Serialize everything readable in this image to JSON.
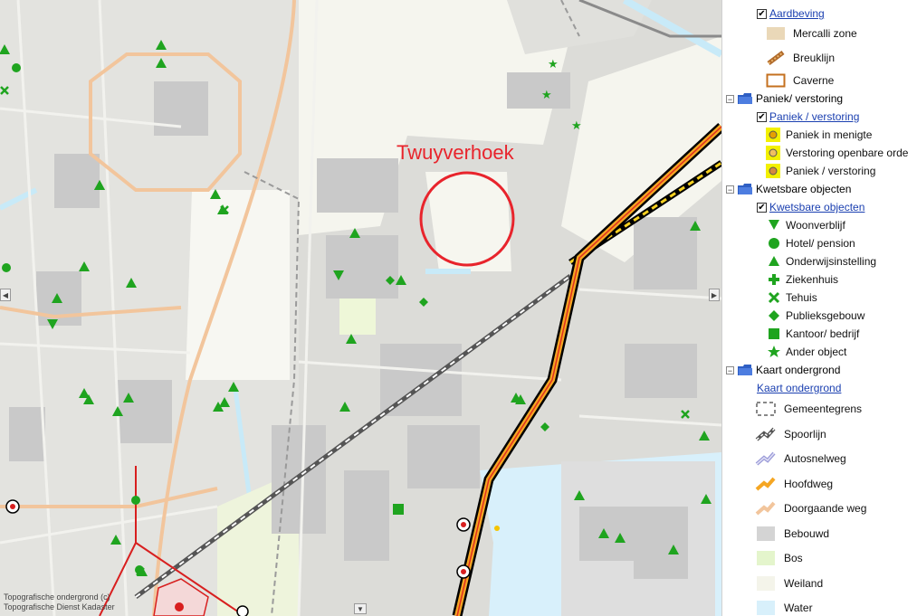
{
  "map": {
    "label": "Twuyverhoek",
    "copyright_line1": "Topografische ondergrond (c)",
    "copyright_line2": "Topografische Dienst Kadaster",
    "colors": {
      "built": "#d4d4d4",
      "meadow": "#f4f4ea",
      "water": "#d8f0fb",
      "forest": "#e4f5cc",
      "highway_outer": "#000000",
      "highway_inner": "#f5a623",
      "label_red": "#e8242c",
      "marker_green": "#1fa41f"
    }
  },
  "legend": {
    "aardbeving": {
      "layer_label": "Aardbeving",
      "items": [
        {
          "label": "Mercalli zone",
          "icon": "mercalli-zone-swatch"
        },
        {
          "label": "Breuklijn",
          "icon": "fault-line-icon"
        },
        {
          "label": "Caverne",
          "icon": "cavern-outline-icon"
        }
      ]
    },
    "paniek": {
      "group_label": "Paniek/ verstoring",
      "layer_label": "Paniek / verstoring",
      "items": [
        {
          "label": "Paniek in menigte",
          "icon": "panic-crowd-icon"
        },
        {
          "label": "Verstoring openbare orde",
          "icon": "public-order-icon"
        },
        {
          "label": "Paniek / verstoring",
          "icon": "panic-disturbance-icon"
        }
      ]
    },
    "kwetsbare": {
      "group_label": "Kwetsbare objecten",
      "layer_label": "Kwetsbare objecten",
      "items": [
        {
          "label": "Woonverblijf",
          "icon": "triangle-down-icon"
        },
        {
          "label": "Hotel/ pension",
          "icon": "circle-icon"
        },
        {
          "label": "Onderwijsinstelling",
          "icon": "triangle-up-icon"
        },
        {
          "label": "Ziekenhuis",
          "icon": "plus-icon"
        },
        {
          "label": "Tehuis",
          "icon": "x-mark-icon"
        },
        {
          "label": "Publieksgebouw",
          "icon": "diamond-icon"
        },
        {
          "label": "Kantoor/ bedrijf",
          "icon": "square-icon"
        },
        {
          "label": "Ander object",
          "icon": "star-icon"
        }
      ]
    },
    "ondergrond": {
      "group_label": "Kaart ondergrond",
      "layer_label": "Kaart ondergrond",
      "items": [
        {
          "label": "Gemeentegrens",
          "icon": "municipal-border-icon"
        },
        {
          "label": "Spoorlijn",
          "icon": "railway-icon"
        },
        {
          "label": "Autosnelweg",
          "icon": "motorway-icon"
        },
        {
          "label": "Hoofdweg",
          "icon": "main-road-icon"
        },
        {
          "label": "Doorgaande weg",
          "icon": "through-road-icon"
        },
        {
          "label": "Bebouwd",
          "icon": "built-area-swatch"
        },
        {
          "label": "Bos",
          "icon": "forest-swatch"
        },
        {
          "label": "Weiland",
          "icon": "meadow-swatch"
        },
        {
          "label": "Water",
          "icon": "water-swatch"
        }
      ]
    }
  }
}
